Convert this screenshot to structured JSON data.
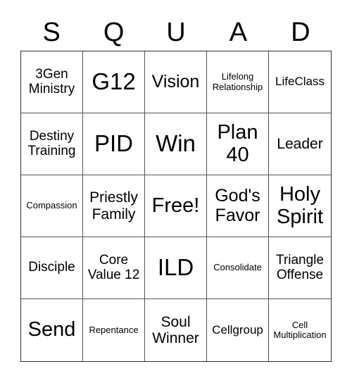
{
  "card": {
    "header": [
      "S",
      "Q",
      "U",
      "A",
      "D"
    ],
    "cells": [
      "3Gen Ministry",
      "G12",
      "Vision",
      "Lifelong Relationship",
      "LifeClass",
      "Destiny Training",
      "PID",
      "Win",
      "Plan 40",
      "Leader",
      "Compassion",
      "Priestly Family",
      "Free!",
      "God's Favor",
      "Holy Spirit",
      "Disciple",
      "Core Value 12",
      "ILD",
      "Consolidate",
      "Triangle Offense",
      "Send",
      "Repentance",
      "Soul Winner",
      "Cellgroup",
      "Cell Multiplication"
    ]
  }
}
